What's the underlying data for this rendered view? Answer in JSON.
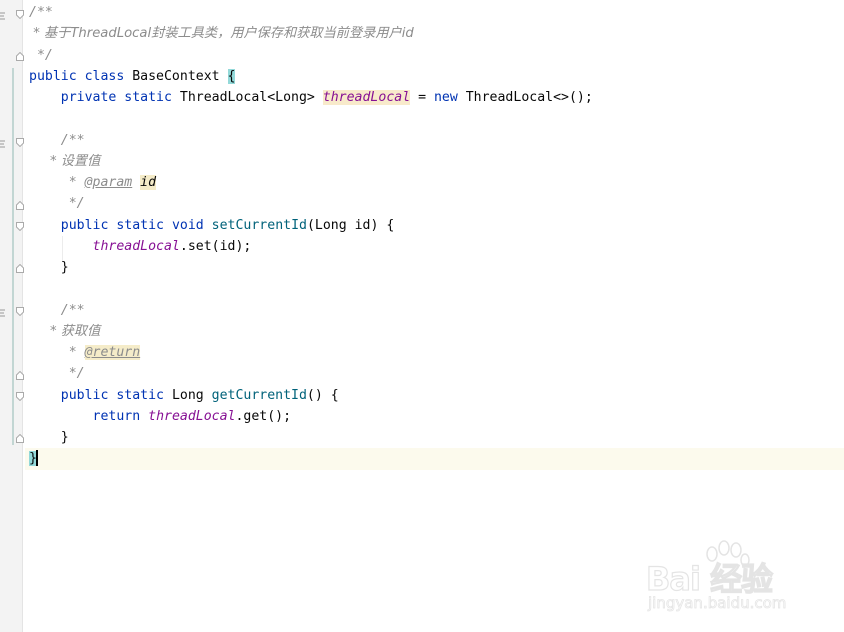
{
  "editor": {
    "lines": [
      {
        "segments": [
          {
            "t": "/**",
            "c": "cmt"
          }
        ]
      },
      {
        "segments": [
          {
            "t": " * 基于ThreadLocal封装工具类，用户保存和获取当前登录用户id",
            "c": "cmt-cjk"
          }
        ]
      },
      {
        "segments": [
          {
            "t": " */",
            "c": "cmt"
          }
        ]
      },
      {
        "segments": [
          {
            "t": "public",
            "c": "kw"
          },
          {
            "t": " "
          },
          {
            "t": "class",
            "c": "kw"
          },
          {
            "t": " BaseContext "
          },
          {
            "t": "{",
            "c": "brace-match"
          }
        ]
      },
      {
        "segments": [
          {
            "t": "    "
          },
          {
            "t": "private",
            "c": "kw"
          },
          {
            "t": " "
          },
          {
            "t": "static",
            "c": "kw"
          },
          {
            "t": " ThreadLocal<Long> "
          },
          {
            "t": "threadLocal",
            "c": "field field-hl"
          },
          {
            "t": " = "
          },
          {
            "t": "new",
            "c": "kw"
          },
          {
            "t": " ThreadLocal<>();"
          }
        ]
      },
      {
        "segments": []
      },
      {
        "segments": [
          {
            "t": "    /**",
            "c": "cmt"
          }
        ]
      },
      {
        "segments": [
          {
            "t": "     * 设置值",
            "c": "cmt-cjk"
          }
        ]
      },
      {
        "segments": [
          {
            "t": "     * ",
            "c": "cmt"
          },
          {
            "t": "@param",
            "c": "tag"
          },
          {
            "t": " ",
            "c": "cmt"
          },
          {
            "t": "id",
            "c": "param"
          }
        ]
      },
      {
        "segments": [
          {
            "t": "     */",
            "c": "cmt"
          }
        ]
      },
      {
        "segments": [
          {
            "t": "    "
          },
          {
            "t": "public",
            "c": "kw"
          },
          {
            "t": " "
          },
          {
            "t": "static",
            "c": "kw"
          },
          {
            "t": " "
          },
          {
            "t": "void",
            "c": "kw"
          },
          {
            "t": " "
          },
          {
            "t": "setCurrentId",
            "c": "method"
          },
          {
            "t": "(Long id) {"
          }
        ]
      },
      {
        "segments": [
          {
            "t": "        "
          },
          {
            "t": "threadLocal",
            "c": "field"
          },
          {
            "t": ".set(id);"
          }
        ]
      },
      {
        "segments": [
          {
            "t": "    }"
          }
        ]
      },
      {
        "segments": []
      },
      {
        "segments": [
          {
            "t": "    /**",
            "c": "cmt"
          }
        ]
      },
      {
        "segments": [
          {
            "t": "     * 获取值",
            "c": "cmt-cjk"
          }
        ]
      },
      {
        "segments": [
          {
            "t": "     * ",
            "c": "cmt"
          },
          {
            "t": "@return",
            "c": "tag tag-hl"
          }
        ]
      },
      {
        "segments": [
          {
            "t": "     */",
            "c": "cmt"
          }
        ]
      },
      {
        "segments": [
          {
            "t": "    "
          },
          {
            "t": "public",
            "c": "kw"
          },
          {
            "t": " "
          },
          {
            "t": "static",
            "c": "kw"
          },
          {
            "t": " Long "
          },
          {
            "t": "getCurrentId",
            "c": "method"
          },
          {
            "t": "() {"
          }
        ]
      },
      {
        "segments": [
          {
            "t": "        "
          },
          {
            "t": "return",
            "c": "kw"
          },
          {
            "t": " "
          },
          {
            "t": "threadLocal",
            "c": "field"
          },
          {
            "t": ".get();"
          }
        ]
      },
      {
        "segments": [
          {
            "t": "    }"
          }
        ]
      },
      {
        "segments": [
          {
            "t": "}",
            "c": "brace-match"
          }
        ],
        "current": true,
        "caret": true
      }
    ]
  },
  "watermark": {
    "brand": "Bai 经验",
    "url": "jingyan.baidu.com"
  },
  "colors": {
    "keyword": "#0033b3",
    "comment": "#8c8c8c",
    "field": "#871094",
    "method": "#00627a",
    "current_line": "#fcfaed",
    "brace_match": "#93d9d9"
  }
}
